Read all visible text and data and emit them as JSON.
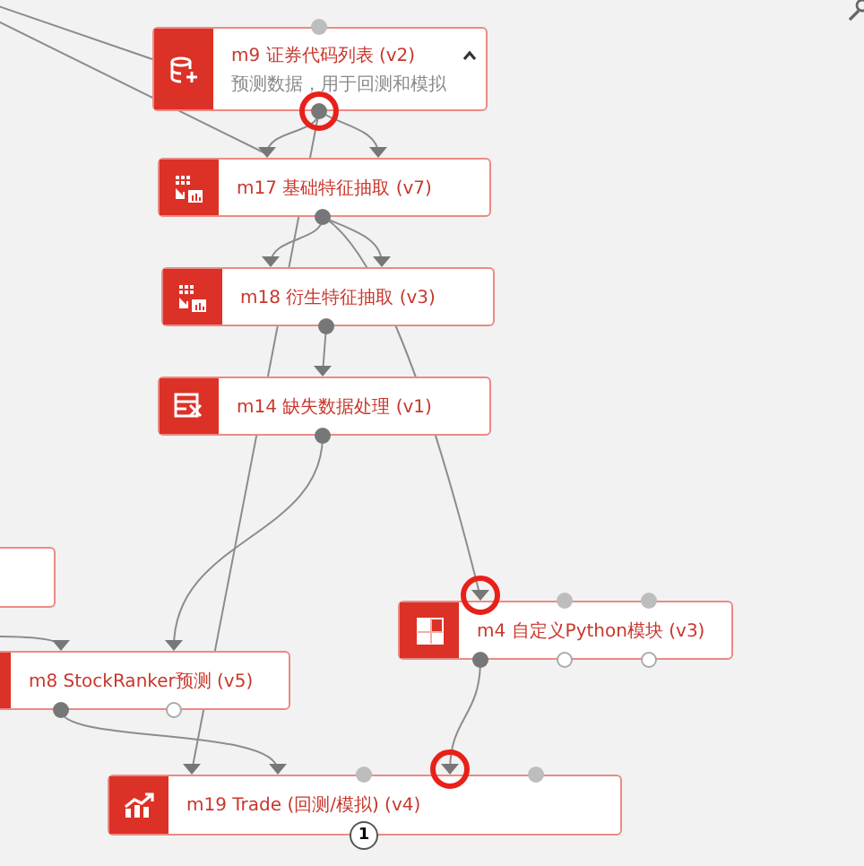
{
  "canvas": {
    "nodes": [
      {
        "kind": "module",
        "title": "m9 证券代码列表 (v2)",
        "subtitle": "预测数据，用于回测和模拟",
        "expanded": true,
        "inputs": [
          {
            "connected": false,
            "highlighted": false
          }
        ],
        "outputs": [
          {
            "connected": true,
            "highlighted": true
          }
        ]
      },
      {
        "kind": "module",
        "title": "m17 基础特征抽取 (v7)",
        "inputs": [
          {
            "connected": true,
            "highlighted": false
          },
          {
            "connected": true,
            "highlighted": false
          }
        ],
        "outputs": [
          {
            "connected": true,
            "highlighted": false
          }
        ]
      },
      {
        "kind": "module",
        "title": "m18 衍生特征抽取 (v3)",
        "inputs": [
          {
            "connected": true,
            "highlighted": false
          },
          {
            "connected": true,
            "highlighted": false
          }
        ],
        "outputs": [
          {
            "connected": true,
            "highlighted": false
          }
        ]
      },
      {
        "kind": "module",
        "title": "m14 缺失数据处理 (v1)",
        "inputs": [
          {
            "connected": true,
            "highlighted": false
          }
        ],
        "outputs": [
          {
            "connected": true,
            "highlighted": false
          }
        ]
      },
      {
        "kind": "module"
      },
      {
        "kind": "module",
        "title": "m4 自定义Python模块 (v3)",
        "inputs": [
          {
            "connected": true,
            "highlighted": true
          },
          {
            "connected": false,
            "highlighted": false
          },
          {
            "connected": false,
            "highlighted": false
          }
        ],
        "outputs": [
          {
            "connected": true,
            "highlighted": false
          },
          {
            "connected": false,
            "highlighted": false
          },
          {
            "connected": false,
            "highlighted": false
          }
        ]
      },
      {
        "kind": "module",
        "title": "m8 StockRanker预测 (v5)",
        "inputs": [
          {
            "connected": true,
            "highlighted": false
          },
          {
            "connected": true,
            "highlighted": false
          }
        ],
        "outputs": [
          {
            "connected": true,
            "highlighted": false
          },
          {
            "connected": false,
            "highlighted": false
          }
        ]
      },
      {
        "kind": "module",
        "title": "m19 Trade (回测/模拟) (v4)",
        "badge": "1",
        "inputs": [
          {
            "connected": true,
            "highlighted": false
          },
          {
            "connected": true,
            "highlighted": false
          },
          {
            "connected": false,
            "highlighted": false
          },
          {
            "connected": true,
            "highlighted": true
          },
          {
            "connected": false,
            "highlighted": false
          }
        ]
      }
    ]
  }
}
